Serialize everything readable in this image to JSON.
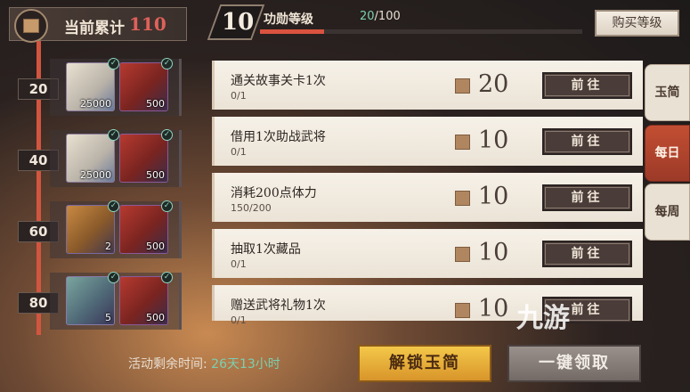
{
  "header": {
    "cumulative_label": "当前累计",
    "cumulative_value": "110",
    "level_value": "10",
    "level_title": "功勋等级",
    "level_current": "20",
    "level_total": "/100",
    "level_progress": 0.2,
    "buy_level_label": "购买等级"
  },
  "rewards": [
    {
      "milestone": "20",
      "items": [
        {
          "icon": "scroll-icon",
          "qty": "25000",
          "claimed": true
        },
        {
          "icon": "book-icon",
          "qty": "500",
          "claimed": true
        }
      ]
    },
    {
      "milestone": "40",
      "items": [
        {
          "icon": "scroll-icon",
          "qty": "25000",
          "claimed": true
        },
        {
          "icon": "book-icon",
          "qty": "500",
          "claimed": true
        }
      ]
    },
    {
      "milestone": "60",
      "items": [
        {
          "icon": "food-icon",
          "qty": "2",
          "claimed": true
        },
        {
          "icon": "book-icon",
          "qty": "500",
          "claimed": true
        }
      ]
    },
    {
      "milestone": "80",
      "items": [
        {
          "icon": "bag-icon",
          "qty": "5",
          "claimed": true
        },
        {
          "icon": "book-icon",
          "qty": "500",
          "claimed": true
        }
      ]
    }
  ],
  "tasks": [
    {
      "title": "通关故事关卡1次",
      "progress": "0/1",
      "points": "20",
      "button": "前往"
    },
    {
      "title": "借用1次助战武将",
      "progress": "0/1",
      "points": "10",
      "button": "前往"
    },
    {
      "title": "消耗200点体力",
      "progress": "150/200",
      "points": "10",
      "button": "前往"
    },
    {
      "title": "抽取1次藏品",
      "progress": "0/1",
      "points": "10",
      "button": "前往"
    },
    {
      "title": "赠送武将礼物1次",
      "progress": "0/1",
      "points": "10",
      "button": "前往"
    }
  ],
  "tabs": [
    {
      "label": "玉简",
      "active": false
    },
    {
      "label": "每日",
      "active": true
    },
    {
      "label": "每周",
      "active": false
    }
  ],
  "footer": {
    "remaining_label": "活动剩余时间:",
    "remaining_value": "26天13小时",
    "unlock_button": "解锁玉简",
    "claim_all_button": "一键领取"
  },
  "watermark": "九游",
  "colors": {
    "accent": "#d2553f",
    "progress_green": "#7ad0b0",
    "unlock_gold": "#e8b03a"
  }
}
